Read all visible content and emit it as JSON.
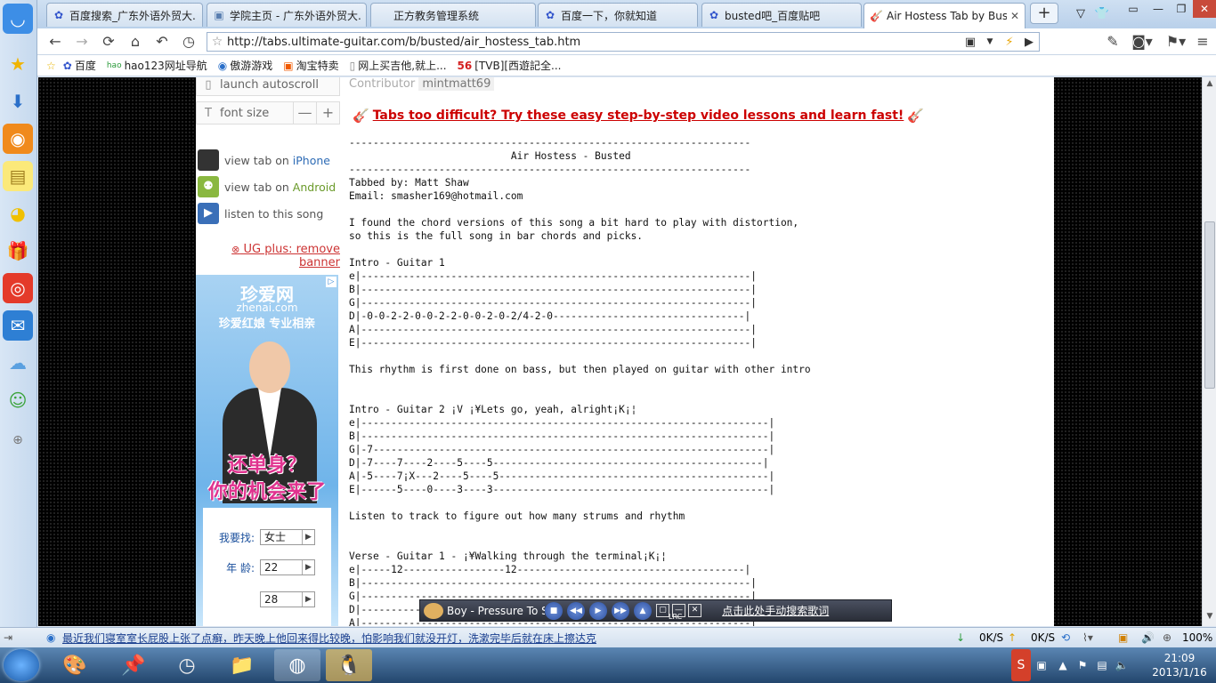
{
  "browser": {
    "tabs": [
      {
        "label": "百度搜索_广东外语外贸大...",
        "icon": "baidu-icon"
      },
      {
        "label": "学院主页 - 广东外语外贸大...",
        "icon": "page-icon"
      },
      {
        "label": "正方教务管理系统",
        "icon": "page-icon"
      },
      {
        "label": "百度一下，你就知道",
        "icon": "baidu-icon"
      },
      {
        "label": "busted吧_百度贴吧",
        "icon": "baidu-icon"
      },
      {
        "label": "Air Hostess Tab by Bust...",
        "icon": "guitar-icon"
      }
    ],
    "new_tab": "+",
    "url": "http://tabs.ultimate-guitar.com/b/busted/air_hostess_tab.htm",
    "bookmarks": [
      "百度",
      "hao123网址导航",
      "傲游游戏",
      "淘宝特卖",
      "网上买吉他,就上...",
      "[TVB][西遊記全..."
    ]
  },
  "sidebar_left": {
    "controls": {
      "autoscroll": "launch autoscroll",
      "font_size": "font size",
      "minus": "—",
      "plus": "+"
    },
    "mobile": [
      {
        "prefix": "view tab on",
        "highlight": "iPhone"
      },
      {
        "prefix": "view tab on",
        "highlight": "Android"
      },
      {
        "prefix": "listen to this song",
        "highlight": ""
      }
    ],
    "ug_plus": "UG plus: remove banner"
  },
  "ad": {
    "title": "珍爱网",
    "site": "zhenai.com",
    "slogan": "珍爱红娘 专业相亲",
    "big1": "还单身？",
    "big2": "你的机会来了",
    "form": [
      {
        "label": "我要找:",
        "value": "女士"
      },
      {
        "label": "年    龄:",
        "value": "22"
      },
      {
        "label": "",
        "value": "28"
      }
    ]
  },
  "main": {
    "contributor_label": "Contributor",
    "contributor_name": "mintmatt69",
    "promo": "Tabs too difficult? Try these easy step-by-step video lessons and learn fast!",
    "tab_text": "-------------------------------------------------------------------\n                           Air Hostess - Busted\n-------------------------------------------------------------------\nTabbed by: Matt Shaw\nEmail: smasher169@hotmail.com\n\nI found the chord versions of this song a bit hard to play with distortion,\nso this is the full song in bar chords and picks.\n\nIntro - Guitar 1\ne|-----------------------------------------------------------------|\nB|-----------------------------------------------------------------|\nG|-----------------------------------------------------------------|\nD|-0-0-2-2-0-0-2-2-0-0-2-0-2/4-2-0--------------------------------|\nA|-----------------------------------------------------------------|\nE|-----------------------------------------------------------------|\n\nThis rhythm is first done on bass, but then played on guitar with other intro\n\n\nIntro - Guitar 2 ¡V ¡¥Lets go, yeah, alright¡K¡¦\ne|--------------------------------------------------------------------|\nB|--------------------------------------------------------------------|\nG|-7------------------------------------------------------------------|\nD|-7----7----2----5----5---------------------------------------------|\nA|-5----7¡X---2----5----5---------------------------------------------|\nE|------5----0----3----3----------------------------------------------|\n\nListen to track to figure out how many strums and rhythm\n\n\nVerse - Guitar 1 - ¡¥Walking through the terminal¡K¡¦\ne|-----12-----------------12--------------------------------------|\nB|-----------------------------------------------------------------|\nG|-----------------------------------------------------------------|\nD|-----------------------------------------------------------------|\nA|-----------------------------------------------------------------|"
  },
  "media": {
    "title": "Boy - Pressure To S",
    "lrc": "LRC",
    "lyrics_link": "点击此处手动搜索歌词"
  },
  "status": {
    "message": "最近我们寝室室长屁股上张了点癣，昨天晚上他回来得比较晚，怕影响我们就没开灯，洗漱完毕后就在床上擦达克",
    "down_speed": "0K/S",
    "up_speed": "0K/S",
    "zoom": "100%"
  },
  "taskbar": {
    "time": "21:09",
    "date": "2013/1/16"
  }
}
